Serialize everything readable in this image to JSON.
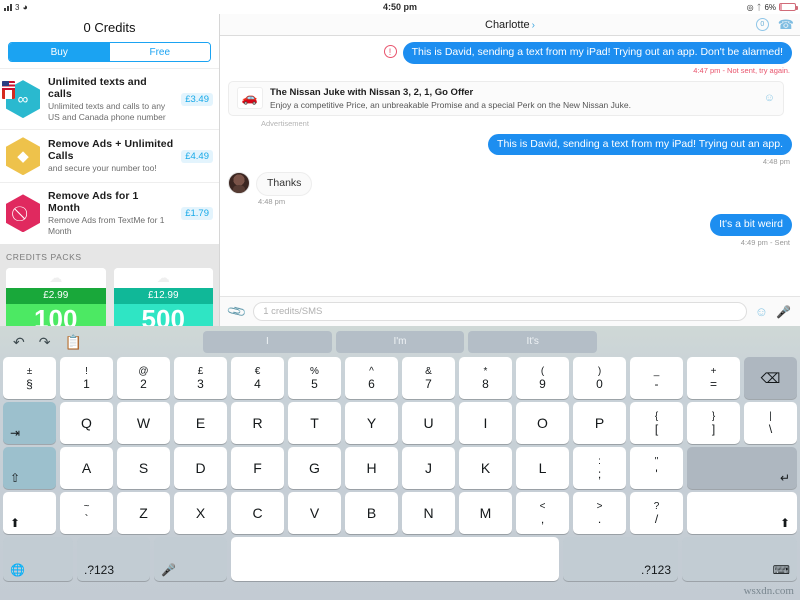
{
  "status_bar": {
    "carrier": "3",
    "wifi_icon": "wifi-icon",
    "time": "4:50 pm",
    "location_icon": "location-icon",
    "bluetooth_icon": "bluetooth-icon",
    "battery_percent": "6%"
  },
  "store": {
    "title": "0 Credits",
    "tabs": [
      {
        "label": "Buy",
        "active": true
      },
      {
        "label": "Free",
        "active": false
      }
    ],
    "products": [
      {
        "icon": "infinity-hexagon-icon",
        "title": "Unlimited texts and calls",
        "subtitle": "Unlimited texts and calls to any US and Canada phone number",
        "price": "£3.49"
      },
      {
        "icon": "diamond-hexagon-icon",
        "title": "Remove Ads + Unlimited Calls",
        "subtitle": "and secure your number too!",
        "price": "£4.49"
      },
      {
        "icon": "no-entry-hexagon-icon",
        "title": "Remove Ads for 1 Month",
        "subtitle": "Remove Ads from TextMe for 1 Month",
        "price": "£1.79"
      }
    ],
    "credits_packs": {
      "section_label": "CREDITS PACKS",
      "packs": [
        {
          "price": "£2.99",
          "credits": "100"
        },
        {
          "price": "£12.99",
          "credits": "500"
        }
      ]
    }
  },
  "chat": {
    "contact_name": "Charlotte",
    "chevron": "›",
    "credits_badge": "0",
    "call_icon": "phone-icon",
    "messages": [
      {
        "direction": "out",
        "text": "This is David, sending a text from my iPad! Trying out an app. Don't be alarmed!",
        "meta": "4:47 pm - Not sent, try again.",
        "error": true
      },
      {
        "direction": "ad",
        "ad_title": "The Nissan Juke with Nissan 3, 2, 1, Go Offer",
        "ad_subtitle": "Enjoy a competitive Price, an unbreakable Promise and a special Perk on the New Nissan Juke.",
        "ad_label": "Advertisement"
      },
      {
        "direction": "out",
        "text": "This is David, sending a text from my iPad! Trying out an app.",
        "meta": "4:48 pm",
        "error": false
      },
      {
        "direction": "in",
        "text": "Thanks",
        "meta": "4:48 pm"
      },
      {
        "direction": "out",
        "text": "It's a bit weird",
        "meta": "4:49 pm - Sent",
        "error": false
      }
    ],
    "composer": {
      "attach_icon": "paperclip-icon",
      "placeholder": "1 credits/SMS",
      "value": "",
      "emoji_icon": "smiley-icon",
      "mic_icon": "microphone-icon"
    }
  },
  "keyboard": {
    "undo_icon": "undo-icon",
    "redo_icon": "redo-icon",
    "paste_icon": "paste-icon",
    "predictions": [
      "I",
      "I'm",
      "It's"
    ],
    "row_numbers": [
      {
        "up": "±",
        "lo": "§"
      },
      {
        "up": "!",
        "lo": "1"
      },
      {
        "up": "@",
        "lo": "2"
      },
      {
        "up": "£",
        "lo": "3"
      },
      {
        "up": "€",
        "lo": "4"
      },
      {
        "up": "%",
        "lo": "5"
      },
      {
        "up": "^",
        "lo": "6"
      },
      {
        "up": "&",
        "lo": "7"
      },
      {
        "up": "*",
        "lo": "8"
      },
      {
        "up": "(",
        "lo": "9"
      },
      {
        "up": ")",
        "lo": "0"
      },
      {
        "up": "_",
        "lo": "-"
      },
      {
        "up": "+",
        "lo": "="
      }
    ],
    "backspace_icon": "backspace-icon",
    "tab_icon": "tab-icon",
    "row_q": [
      "Q",
      "W",
      "E",
      "R",
      "T",
      "Y",
      "U",
      "I",
      "O",
      "P"
    ],
    "row_q_extra": [
      {
        "up": "{",
        "lo": "["
      },
      {
        "up": "}",
        "lo": "]"
      },
      {
        "up": "|",
        "lo": "\\"
      }
    ],
    "caps_icon": "caps-lock-icon",
    "row_a": [
      "A",
      "S",
      "D",
      "F",
      "G",
      "H",
      "J",
      "K",
      "L"
    ],
    "row_a_extra": [
      {
        "up": ":",
        "lo": ";"
      },
      {
        "up": "\"",
        "lo": "'"
      }
    ],
    "enter_icon": "return-icon",
    "shift_left_icon": "shift-icon",
    "tilde_key": {
      "up": "~",
      "lo": "`"
    },
    "row_z": [
      "Z",
      "X",
      "C",
      "V",
      "B",
      "N",
      "M"
    ],
    "row_z_extra": [
      {
        "up": "<",
        "lo": ","
      },
      {
        "up": ">",
        "lo": "."
      },
      {
        "up": "?",
        "lo": "/"
      }
    ],
    "shift_right_icon": "shift-icon",
    "globe_icon": "globe-icon",
    "numeric_left_label": ".?123",
    "dictation_icon": "microphone-icon",
    "space_label": "",
    "numeric_right_label": ".?123",
    "hide_keyboard_icon": "hide-keyboard-icon"
  },
  "watermark": "wsxdn.com"
}
